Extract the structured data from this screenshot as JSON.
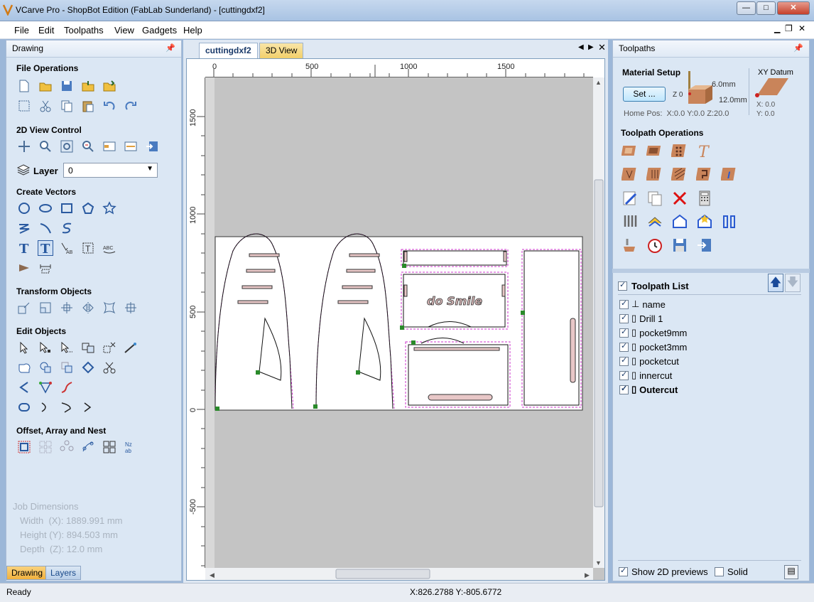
{
  "window": {
    "title": "VCarve Pro - ShopBot Edition (FabLab Sunderland) - [cuttingdxf2]",
    "min": "—",
    "max": "□",
    "close": "✕"
  },
  "menu": [
    "File",
    "Edit",
    "Toolpaths",
    "View",
    "Gadgets",
    "Help"
  ],
  "mdi": {
    "min": "▁",
    "restore": "❐",
    "close": "✕"
  },
  "drawing_panel": {
    "title": "Drawing",
    "sections": {
      "file_ops": "File Operations",
      "view_ctrl": "2D View Control",
      "layer_label": "Layer",
      "layer_value": "0",
      "create_vectors": "Create Vectors",
      "transform": "Transform Objects",
      "edit": "Edit Objects",
      "offset": "Offset, Array and Nest"
    },
    "job": {
      "title": "Job Dimensions",
      "width": "Width  (X): 1889.991 mm",
      "height": "Height (Y): 894.503 mm",
      "depth": "Depth  (Z): 12.0 mm"
    },
    "tabs": [
      "Drawing",
      "Layers"
    ]
  },
  "doc": {
    "tabs": [
      "cuttingdxf2",
      "3D View"
    ],
    "ruler_top": [
      "0",
      "500",
      "1000",
      "1500"
    ],
    "ruler_left": [
      "1500",
      "1000",
      "500",
      "0",
      "-500"
    ],
    "text_on_design": "do Smile"
  },
  "toolpaths_panel": {
    "title": "Toolpaths",
    "material_setup": "Material Setup",
    "set_button": "Set ...",
    "z0": "Z 0",
    "thickness1": "6.0mm",
    "thickness2": "12.0mm",
    "home_pos": "Home Pos:  X:0.0 Y:0.0 Z:20.0",
    "xy_datum": "XY Datum",
    "datum_x": "X: 0.0",
    "datum_y": "Y: 0.0",
    "ops_title": "Toolpath Operations",
    "list_title": "Toolpath List",
    "list": [
      "name",
      "Drill 1",
      "pocket9mm",
      "pocket3mm",
      "pocketcut",
      "innercut",
      "Outercut"
    ],
    "show_2d": "Show 2D previews",
    "solid": "Solid"
  },
  "status": {
    "left": "Ready",
    "coords": "X:826.2788 Y:-805.6772"
  },
  "colors": {
    "accent": "#3b6db5",
    "vector_magenta": "#cc33cc",
    "toolpath_brown": "#a0522d"
  }
}
